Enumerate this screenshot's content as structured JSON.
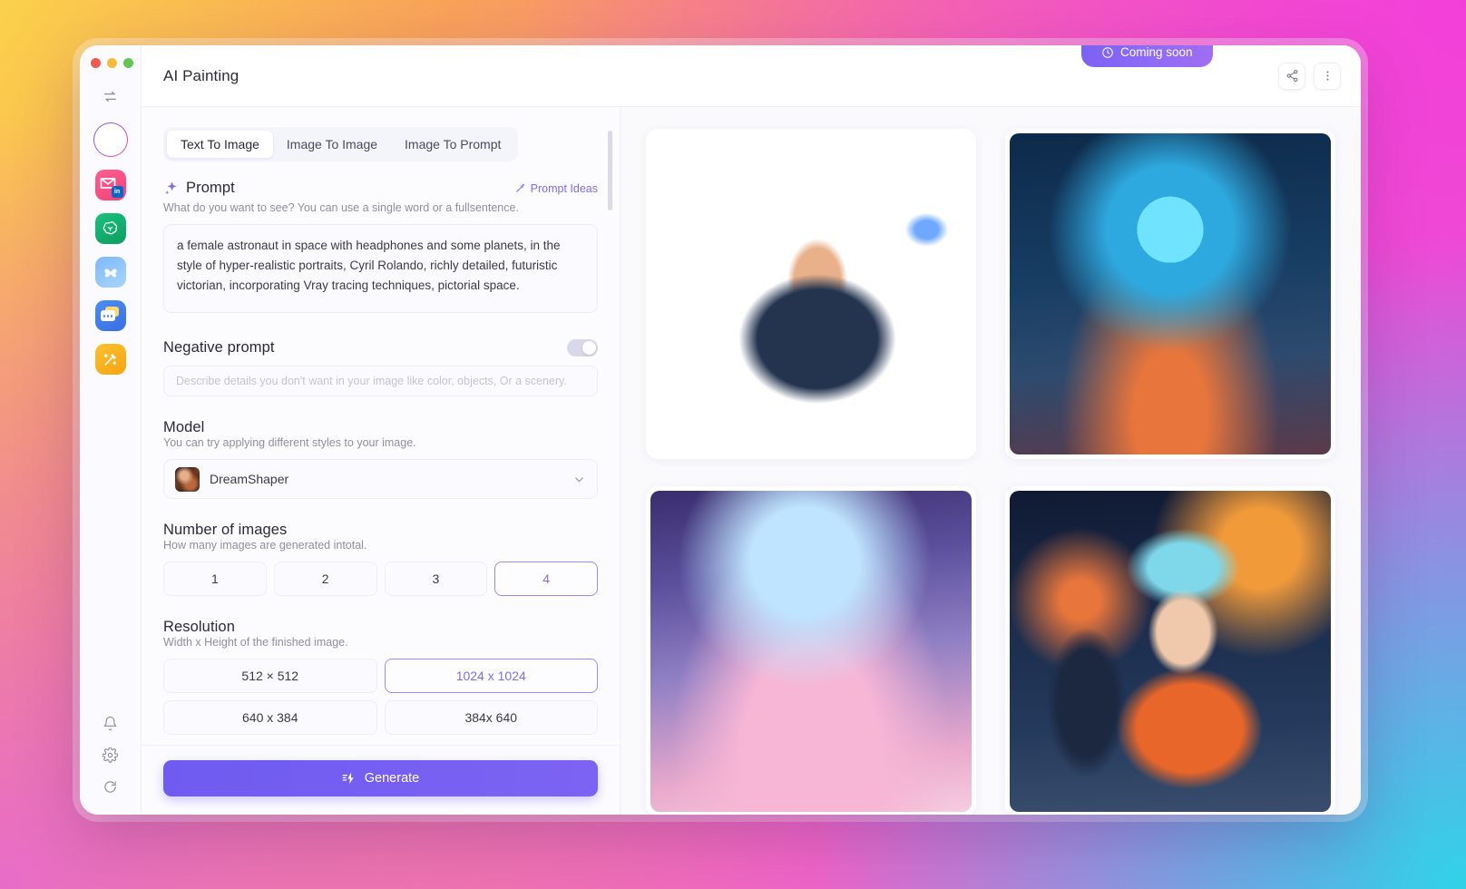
{
  "window": {
    "traffic_lights": [
      "close",
      "minimize",
      "maximize"
    ],
    "colors": {
      "accent": "#7c6df0",
      "generate_button": "#6f5bf0",
      "coming_soon_badge": "#8f6bf6",
      "selected_border": "#9a8cf5",
      "panel_bg": "#fcfcff",
      "gallery_bg": "#fafafd"
    }
  },
  "rail": {
    "collapse_icon": "collapse-sidebar-icon",
    "apps": [
      {
        "name": "apps-grid",
        "label": "Apps",
        "icon": "grid-icon",
        "active": true
      },
      {
        "name": "linkedin-mail",
        "label": "LinkedIn Mail",
        "icon": "linkedin-mail-icon",
        "active": false
      },
      {
        "name": "chatgpt",
        "label": "ChatGPT",
        "icon": "chatgpt-icon",
        "active": false
      },
      {
        "name": "butterfly",
        "label": "Butterfly",
        "icon": "butterfly-icon",
        "active": false
      },
      {
        "name": "chat",
        "label": "Chat",
        "icon": "chat-bubbles-icon",
        "active": false
      },
      {
        "name": "ai-painting",
        "label": "AI Painting",
        "icon": "magic-wand-icon",
        "active": false
      }
    ],
    "bottom": [
      {
        "name": "notifications",
        "label": "Notifications",
        "icon": "bell-icon"
      },
      {
        "name": "settings",
        "label": "Settings",
        "icon": "gear-icon"
      },
      {
        "name": "refresh",
        "label": "Refresh",
        "icon": "refresh-icon"
      }
    ]
  },
  "header": {
    "title": "AI Painting",
    "badge": {
      "text": "Coming soon",
      "icon": "clock-icon"
    },
    "actions": [
      {
        "name": "share",
        "label": "Share",
        "icon": "share-icon"
      },
      {
        "name": "more",
        "label": "More options",
        "icon": "more-vertical-icon"
      }
    ]
  },
  "tabs": [
    {
      "label": "Text To Image",
      "active": true
    },
    {
      "label": "Image To Image",
      "active": false
    },
    {
      "label": "Image To Prompt",
      "active": false
    }
  ],
  "prompt": {
    "title": "Prompt",
    "title_icon": "sparkle-icon",
    "ideas_label": "Prompt Ideas",
    "ideas_icon": "magic-wand-small-icon",
    "subtitle": "What do you want to see? You can use a single word or a fullsentence.",
    "value": "a female astronaut in space with headphones and some planets, in the style of hyper-realistic portraits, Cyril Rolando, richly detailed, futuristic victorian, incorporating Vray tracing techniques, pictorial space.",
    "placeholder": "What do you want to see?"
  },
  "negative_prompt": {
    "title": "Negative prompt",
    "enabled": false,
    "value": "",
    "placeholder": "Describe details you don't want in your image like color, objects, Or a scenery."
  },
  "model": {
    "title": "Model",
    "subtitle": "You can try applying different styles to your image.",
    "selected": "DreamShaper",
    "chevron_icon": "chevron-down-icon"
  },
  "number_of_images": {
    "title": "Number of images",
    "subtitle": "How many images are generated intotal.",
    "options": [
      "1",
      "2",
      "3",
      "4"
    ],
    "selected": "4"
  },
  "resolution": {
    "title": "Resolution",
    "subtitle": "Width x Height of the finished image.",
    "options": [
      "512 × 512",
      "1024 x 1024",
      "640 x 384",
      "384x 640"
    ],
    "selected": "1024 x 1024"
  },
  "generate": {
    "label": "Generate",
    "icon": "generate-bolt-icon"
  },
  "gallery": {
    "images": [
      {
        "name": "generated-image-1",
        "alt": "Blonde astronaut with headset before a glowing orange sun",
        "style": "art1"
      },
      {
        "name": "generated-image-2",
        "alt": "Astronaut in blue helmet with headphones among planets",
        "style": "art2"
      },
      {
        "name": "generated-image-3",
        "alt": "Woman in pink dress inside a bubble in space",
        "style": "art3"
      },
      {
        "name": "generated-image-4",
        "alt": "Woman in orange spacesuit with headphones and planets",
        "style": "art4"
      }
    ]
  }
}
